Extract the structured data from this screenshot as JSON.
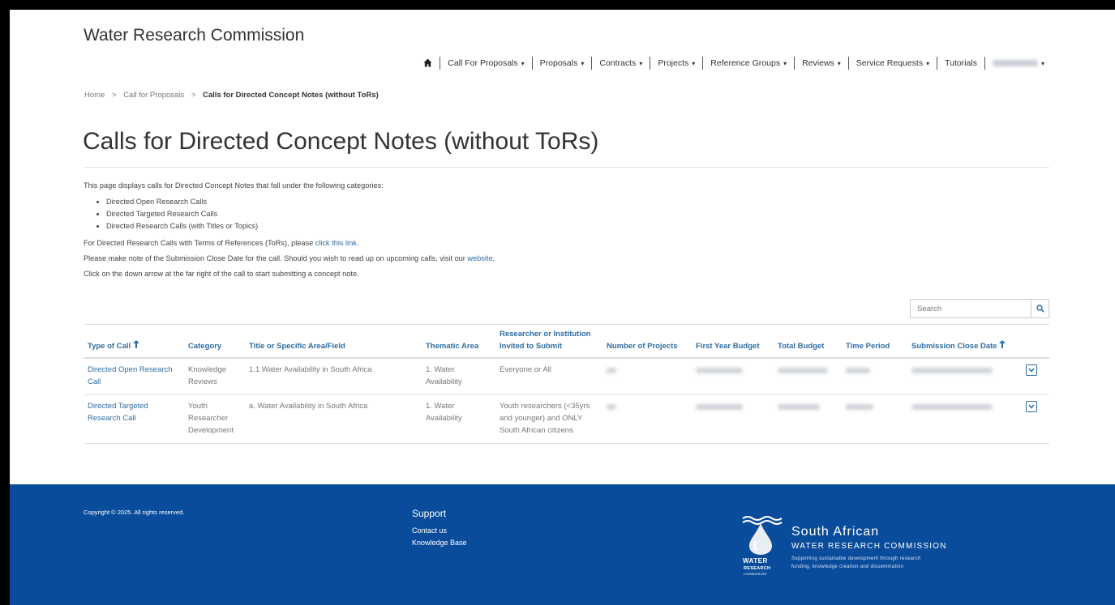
{
  "site": {
    "title": "Water Research Commission"
  },
  "nav": {
    "items": [
      {
        "label": "Call For Proposals"
      },
      {
        "label": "Proposals"
      },
      {
        "label": "Contracts"
      },
      {
        "label": "Projects"
      },
      {
        "label": "Reference Groups"
      },
      {
        "label": "Reviews"
      },
      {
        "label": "Service Requests"
      },
      {
        "label": "Tutorials"
      }
    ]
  },
  "breadcrumb": {
    "home": "Home",
    "parent": "Call for Proposals",
    "current": "Calls for Directed Concept Notes (without ToRs)",
    "separator": ">"
  },
  "page": {
    "title": "Calls for Directed Concept Notes (without ToRs)",
    "intro": "This page displays calls for Directed Concept Notes that fall under the following categories:",
    "categories": [
      "Directed Open Research Calls",
      "Directed Targeted Research Calls",
      "Directed Research Calls (with Titles or Topics)"
    ],
    "tors_text": "For Directed Research Calls with Terms of References (ToRs), please",
    "tors_link": "click this link",
    "note_text": "Please make note of the Submission Close Date for the call. Should you wish to read up on upcoming calls, visit our",
    "note_link": "website",
    "instruction": "Click on the down arrow at the far right of the call to start submitting a concept note.",
    "period": "."
  },
  "search": {
    "placeholder": "Search"
  },
  "table": {
    "headers": {
      "type": "Type of Call",
      "category": "Category",
      "title": "Title or Specific Area/Field",
      "thematic": "Thematic Area",
      "invited": "Researcher or Institution Invited to Submit",
      "projects": "Number of Projects",
      "first_budget": "First Year Budget",
      "total_budget": "Total Budget",
      "time_period": "Time Period",
      "close_date": "Submission Close Date"
    },
    "rows": [
      {
        "type": "Directed Open Research Call",
        "category": "Knowledge Reviews",
        "title": "1.1 Water Availability in South Africa",
        "thematic": "1. Water Availability",
        "invited": "Everyone or All"
      },
      {
        "type": "Directed Targeted Research Call",
        "category": "Youth Researcher Development",
        "title": "a. Water Availability in South Africa",
        "thematic": "1. Water Availability",
        "invited": "Youth researchers (<35yrs and younger) and ONLY South African citizens"
      }
    ]
  },
  "footer": {
    "copyright": "Copyright © 2025. All rights reserved.",
    "support_title": "Support",
    "links": [
      "Contact us",
      "Knowledge Base"
    ],
    "logo": {
      "name_line1": "South African",
      "name_line2": "WATER RESEARCH COMMISSION",
      "tagline1": "Supporting sustainable development through research",
      "tagline2": "funding, knowledge creation and dissemination",
      "word_water": "WATER",
      "word_research": "RESEARCH",
      "word_commission": "COMMISSION"
    }
  },
  "colors": {
    "link": "#2e6da4",
    "footer": "#0a4c9c"
  }
}
